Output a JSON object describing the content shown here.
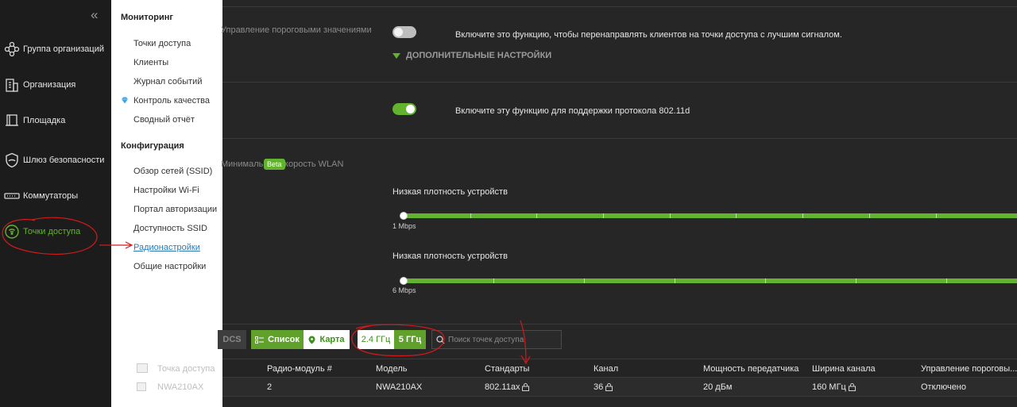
{
  "sidebar": {
    "items": [
      {
        "label": "Группа организаций",
        "icon": "org-group-icon"
      },
      {
        "label": "Организация",
        "icon": "building-icon"
      },
      {
        "label": "Площадка",
        "icon": "site-icon"
      },
      {
        "label": "Шлюз безопасности",
        "icon": "shield-icon"
      },
      {
        "label": "Коммутаторы",
        "icon": "switch-icon"
      },
      {
        "label": "Точки доступа",
        "icon": "access-point-icon",
        "active": true
      }
    ]
  },
  "flyout": {
    "monitoring_title": "Мониторинг",
    "monitoring_items": [
      "Точки доступа",
      "Клиенты",
      "Журнал событий",
      "Контроль качества",
      "Сводный отчёт"
    ],
    "config_title": "Конфигурация",
    "config_items": [
      "Обзор сетей (SSID)",
      "Настройки Wi-Fi",
      "Портал авторизации",
      "Доступность SSID",
      "Радионастройки",
      "Общие настройки"
    ]
  },
  "main": {
    "ghost_threshold": "Управление пороговыми значениями",
    "threshold_desc": "Включите это функцию, чтобы перенаправлять клиентов на точки доступа с лучшим сигналом.",
    "advanced": "ДОПОЛНИТЕЛЬНЫЕ НАСТРОЙКИ",
    "d80211_desc": "Включите эту функцию для поддержки протокола 802.11d",
    "ghost_rate": "Минимальная скорость WLAN",
    "beta": "Beta",
    "slider1": {
      "title": "Низкая плотность устройств",
      "value": "1 Mbps"
    },
    "slider2": {
      "title": "Низкая плотность устройств",
      "value": "6 Mbps"
    },
    "ghost_btn": "DCS",
    "view_list": "Список",
    "view_map": "Карта",
    "band_24": "2.4 ГГц",
    "band_5": "5 ГГц",
    "search_placeholder": "Поиск точек доступа"
  },
  "table": {
    "headers": [
      "Точка доступа",
      "Радио-модуль #",
      "Модель",
      "Стандарты",
      "Канал",
      "Мощность передатчика",
      "Ширина канала",
      "Управление пороговы..."
    ],
    "row": {
      "ap": "NWA210AX",
      "radio": "2",
      "model": "NWA210AX",
      "standard": "802.11ax",
      "channel": "36",
      "power": "20 дБм",
      "width": "160 МГц",
      "threshold": "Отключено"
    }
  },
  "colors": {
    "accent": "#63b32e",
    "annotation": "#d11a1a"
  }
}
